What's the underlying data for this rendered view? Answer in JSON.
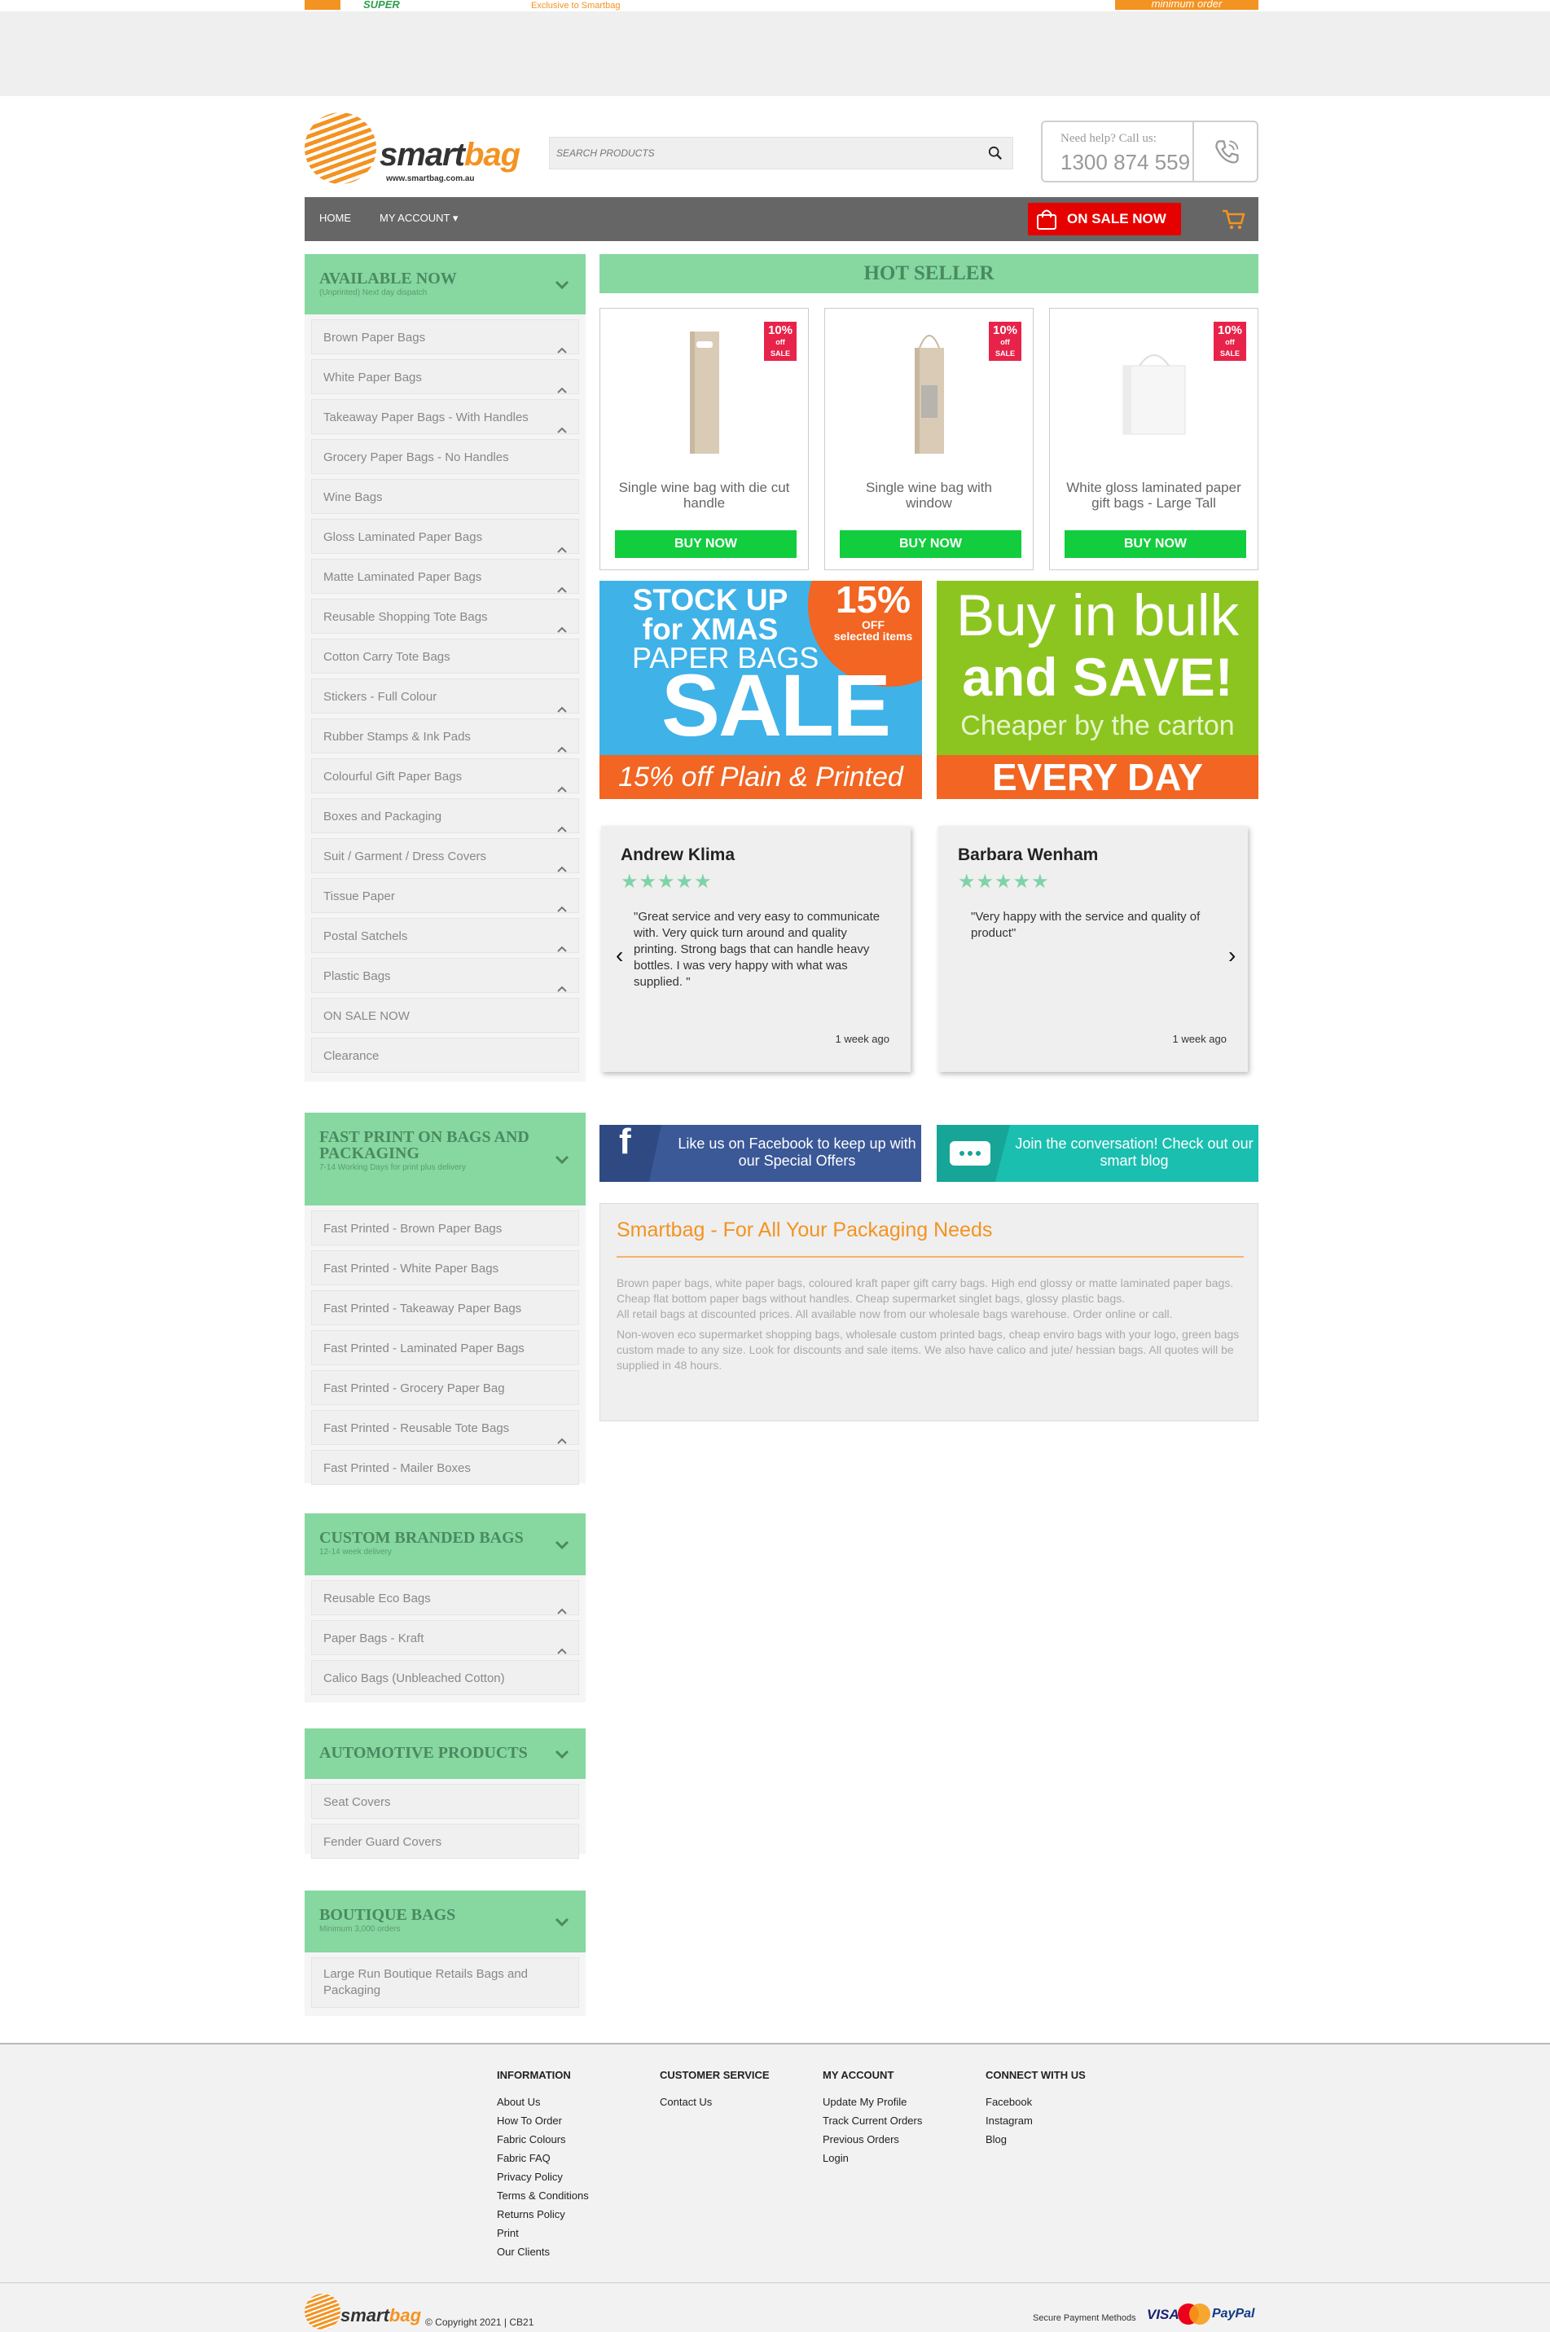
{
  "promo": {
    "left_text": "SUPER",
    "middle_text": "Exclusive to Smartbag",
    "right_text": "minimum order"
  },
  "header": {
    "logo_text": "smartbag",
    "logo_url": "www.smartbag.com.au",
    "search_placeholder": "SEARCH PRODUCTS",
    "help_label": "Need help? Call us:",
    "phone": "1300 874 559"
  },
  "nav": {
    "home": "HOME",
    "account": "MY ACCOUNT ▾",
    "sale": "ON SALE NOW"
  },
  "sidebar": {
    "available": {
      "title": "AVAILABLE NOW",
      "subtitle": "(Unprinted) Next day dispatch",
      "items": [
        "Brown Paper Bags",
        "White Paper Bags",
        "Takeaway Paper Bags - With Handles",
        "Grocery Paper Bags - No Handles",
        "Wine Bags",
        "Gloss Laminated Paper Bags",
        "Matte Laminated Paper Bags",
        "Reusable Shopping Tote Bags",
        "Cotton Carry Tote Bags",
        "Stickers - Full Colour",
        "Rubber Stamps & Ink Pads",
        "Colourful Gift Paper Bags",
        "Boxes and Packaging",
        "Suit / Garment / Dress Covers",
        "Tissue Paper",
        "Postal Satchels",
        "Plastic Bags",
        "ON SALE NOW",
        "Clearance"
      ]
    },
    "fast_print": {
      "title": "FAST PRINT ON BAGS AND PACKAGING",
      "subtitle": "7-14 Working Days for print plus delivery",
      "items": [
        "Fast Printed - Brown Paper Bags",
        "Fast Printed - White Paper Bags",
        "Fast Printed - Takeaway Paper Bags",
        "Fast Printed - Laminated Paper Bags",
        "Fast Printed - Grocery Paper Bag",
        "Fast Printed - Reusable Tote Bags",
        "Fast Printed - Mailer Boxes"
      ]
    },
    "custom": {
      "title": "CUSTOM BRANDED BAGS",
      "subtitle": "12-14 week delivery",
      "items": [
        "Reusable Eco Bags",
        "Paper Bags - Kraft",
        "Calico Bags (Unbleached Cotton)"
      ]
    },
    "automotive": {
      "title": "AUTOMOTIVE PRODUCTS",
      "items": [
        "Seat Covers",
        "Fender Guard Covers"
      ]
    },
    "boutique": {
      "title": "BOUTIQUE BAGS",
      "subtitle": "Minimum 3,000 orders",
      "items": [
        "Large Run Boutique Retails Bags and Packaging"
      ]
    }
  },
  "hot_seller": {
    "title": "HOT SELLER",
    "badge_pct": "10%",
    "badge_off": "off",
    "badge_sale": "SALE",
    "buy_label": "BUY NOW",
    "products": [
      {
        "name": "Single wine bag with die cut handle"
      },
      {
        "name": "Single wine bag with window"
      },
      {
        "name": "White gloss laminated paper gift bags - Large Tall"
      }
    ]
  },
  "banners": {
    "xmas": {
      "stock": "STOCK UP",
      "for": "for XMAS",
      "paper": "PAPER BAGS",
      "sale": "SALE",
      "pct": "15%",
      "off": "OFF",
      "selected": "selected items",
      "bottom": "15% off Plain & Printed"
    },
    "bulk": {
      "l1": "Buy in bulk",
      "l2": "and SAVE!",
      "l3": "Cheaper by the carton",
      "bottom": "EVERY DAY"
    }
  },
  "reviews": [
    {
      "name": "Andrew Klima",
      "stars": "★★★★★",
      "text": "\"Great service and very easy to communicate with. Very quick turn around and quality printing. Strong bags that can handle heavy bottles. I was very happy with what was supplied. \"",
      "time": "1 week ago"
    },
    {
      "name": "Barbara Wenham",
      "stars": "★★★★★",
      "text": "\"Very happy with the service and quality of product\"",
      "time": "1 week ago"
    }
  ],
  "social": {
    "facebook": "Like us on Facebook to keep up with our Special Offers",
    "blog": "Join the conversation! Check out our smart blog"
  },
  "about": {
    "title": "Smartbag - For All Your Packaging Needs",
    "p1": "Brown paper bags, white paper bags, coloured kraft paper gift carry bags. High end glossy or matte laminated paper bags. Cheap flat bottom paper bags without handles. Cheap supermarket singlet bags, glossy plastic bags.",
    "p2": "All retail bags at discounted prices. All available now from our wholesale bags warehouse. Order online or call.",
    "p3": "Non-woven eco supermarket shopping bags, wholesale custom printed bags, cheap enviro bags with your logo, green bags custom made to any size. Look for discounts and sale items. We also have calico and jute/ hessian bags. All quotes will be supplied in 48 hours."
  },
  "footer": {
    "information": {
      "title": "INFORMATION",
      "links": [
        "About Us",
        "How To Order",
        "Fabric Colours",
        "Fabric FAQ",
        "Privacy Policy",
        "Terms & Conditions",
        "Returns Policy",
        "Print",
        "Our Clients"
      ]
    },
    "customer_service": {
      "title": "CUSTOMER SERVICE",
      "links": [
        "Contact Us"
      ]
    },
    "my_account": {
      "title": "MY ACCOUNT",
      "links": [
        "Update My Profile",
        "Track Current Orders",
        "Previous Orders",
        "Login"
      ]
    },
    "connect": {
      "title": "CONNECT WITH US",
      "links": [
        "Facebook",
        "Instagram",
        "Blog"
      ]
    },
    "copyright": "© Copyright 2021 | CB21",
    "secure": "Secure Payment Methods",
    "visa": "VISA",
    "paypal": "PayPal"
  },
  "colors": {
    "accent_green": "#86d7a0",
    "orange": "#f39322",
    "buy_green": "#12cd3d",
    "sale_red": "#e60000"
  }
}
